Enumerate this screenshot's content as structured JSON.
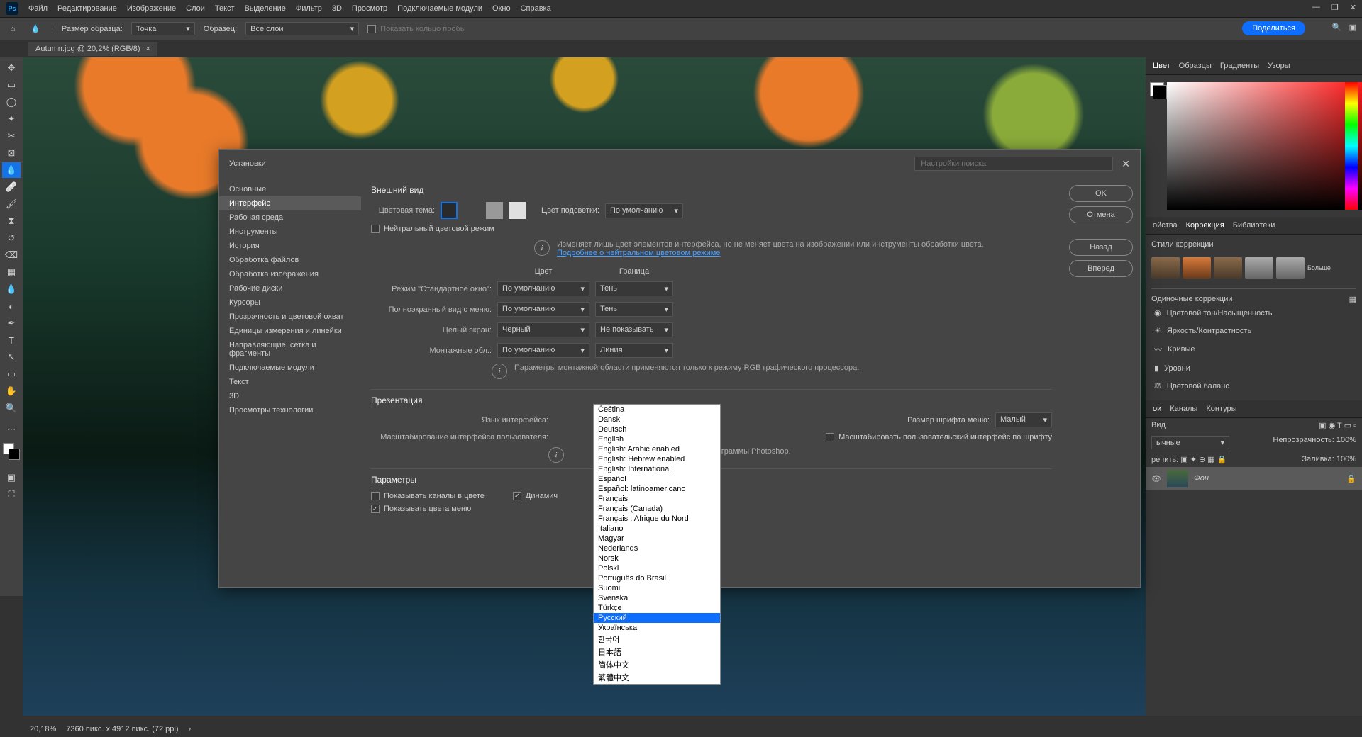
{
  "menu": [
    "Файл",
    "Редактирование",
    "Изображение",
    "Слои",
    "Текст",
    "Выделение",
    "Фильтр",
    "3D",
    "Просмотр",
    "Подключаемые модули",
    "Окно",
    "Справка"
  ],
  "options": {
    "sample_size_label": "Размер образца:",
    "sample_size_value": "Точка",
    "sample_label": "Образец:",
    "sample_value": "Все слои",
    "show_ring": "Показать кольцо пробы"
  },
  "share": "Поделиться",
  "doc_tab": "Autumn.jpg @ 20,2% (RGB/8)",
  "status": {
    "zoom": "20,18%",
    "dims": "7360 пикс. x 4912 пикс. (72 ppi)"
  },
  "panel_tabs": {
    "color": "Цвет",
    "swatches": "Образцы",
    "gradients": "Градиенты",
    "patterns": "Узоры"
  },
  "props_tabs": {
    "props": "ойства",
    "adj": "Коррекция",
    "lib": "Библиотеки"
  },
  "adj": {
    "styles": "Стили коррекции",
    "more": "Больше",
    "single": "Одиночные коррекции",
    "hue": "Цветовой тон/Насыщенность",
    "bright": "Яркость/Контрастность",
    "curves": "Кривые",
    "levels": "Уровни",
    "balance": "Цветовой баланс"
  },
  "layers_tabs": {
    "l": "ои",
    "channels": "Каналы",
    "paths": "Контуры"
  },
  "layers": {
    "kind": "Вид",
    "normal": "ычные",
    "opacity_label": "Непрозрачность:",
    "opacity": "100%",
    "lock": "репить:",
    "fill_label": "Заливка:",
    "fill": "100%",
    "bg": "Фон"
  },
  "dialog": {
    "title": "Установки",
    "search_ph": "Настройки поиска",
    "sidebar": [
      "Основные",
      "Интерфейс",
      "Рабочая среда",
      "Инструменты",
      "История",
      "Обработка файлов",
      "Обработка изображения",
      "Рабочие диски",
      "Курсоры",
      "Прозрачность и цветовой охват",
      "Единицы измерения и линейки",
      "Направляющие, сетка и фрагменты",
      "Подключаемые модули",
      "Текст",
      "3D",
      "Просмотры технологии"
    ],
    "btns": {
      "ok": "OK",
      "cancel": "Отмена",
      "prev": "Назад",
      "next": "Вперед"
    },
    "appearance": "Внешний вид",
    "color_theme": "Цветовая тема:",
    "highlight": "Цвет подсветки:",
    "default": "По умолчанию",
    "neutral": "Нейтральный цветовой режим",
    "neutral_info": "Изменяет лишь цвет элементов интерфейса, но не меняет цвета на изображении или инструменты обработки цвета.",
    "neutral_link": "Подробнее о нейтральном цветовом режиме",
    "col_color": "Цвет",
    "col_border": "Граница",
    "standard": "Режим \"Стандартное окно\":",
    "fullmenu": "Полноэкранный вид с меню:",
    "full": "Целый экран:",
    "artboard": "Монтажные обл.:",
    "black": "Черный",
    "shadow": "Тень",
    "none": "Не показывать",
    "line": "Линия",
    "artboard_note": "Параметры монтажной области применяются только к режиму RGB графического процессора.",
    "presentation": "Презентация",
    "ui_lang": "Язык интерфейса:",
    "font_size": "Размер шрифта меню:",
    "small": "Малый",
    "ui_scale": "Масштабирование интерфейса пользователя:",
    "scale_font": "Масштабировать пользовательский интерфейс по шрифту",
    "restart_note": "осле перезапуска программы Photoshop.",
    "params": "Параметры",
    "show_channels": "Показывать каналы в цвете",
    "dynamic": "Динамич",
    "show_menu": "Показывать цвета меню"
  },
  "languages": [
    "Čeština",
    "Dansk",
    "Deutsch",
    "English",
    "English: Arabic enabled",
    "English: Hebrew enabled",
    "English: International",
    "Español",
    "Español: latinoamericano",
    "Français",
    "Français (Canada)",
    "Français : Afrique du Nord",
    "Italiano",
    "Magyar",
    "Nederlands",
    "Norsk",
    "Polski",
    "Português do Brasil",
    "Suomi",
    "Svenska",
    "Türkçe",
    "Русский",
    "Українська",
    "한국어",
    "日本語",
    "简体中文",
    "繁體中文"
  ],
  "lang_selected": "Русский"
}
